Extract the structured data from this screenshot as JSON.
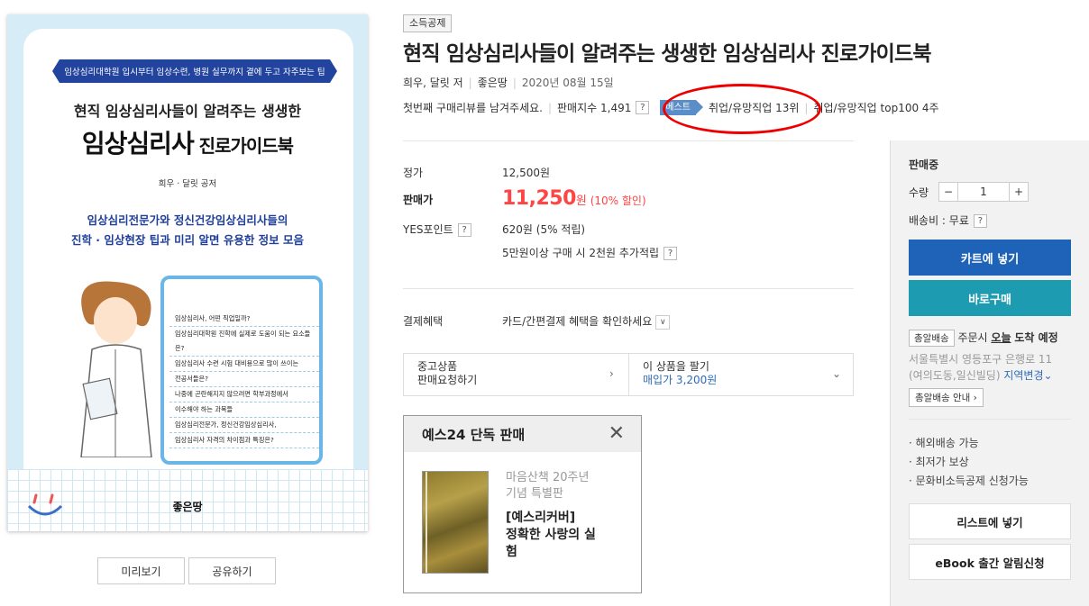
{
  "cover": {
    "banner": "임상심리대학원 입시부터 임상수련, 병원 실무까지 곁에 두고 자주보는 팁",
    "subtitle": "현직 임상심리사들이 알려주는 생생한",
    "title_main": "임상심리사",
    "title_small": " 진로가이드북",
    "authors": "희우 · 달릿 공저",
    "desc_line1": "임상심리전문가와 정신건강임상심리사들의",
    "desc_line2": "진학 · 임상현장 팁과 미리 알면 유용한 정보 모음",
    "panel_items": [
      "임상심리사, 어떤 직업일까?",
      "임상심리대학원 진학에 실제로 도움이 되는 요소들은?",
      "임상심리사 수련 시험 대비용으로 많이 쓰이는",
      "전공서들은?",
      "나중에 곤란해지지 않으려면 학부과정에서",
      "이수해야 하는 과목들",
      "임상심리전문가, 정신건강임상심리사,",
      "임상심리사 자격의 차이점과 특징은?"
    ],
    "publisher": "좋은땅"
  },
  "left_buttons": {
    "preview": "미리보기",
    "share": "공유하기"
  },
  "product": {
    "tag": "소득공제",
    "title": "현직 임상심리사들이 알려주는 생생한 임상심리사 진로가이드북",
    "authors": "희우, 달릿 저",
    "publisher": "좋은땅",
    "date": "2020년 08월 15일",
    "review_prompt": "첫번째 구매리뷰를 남겨주세요.",
    "sales_index": "판매지수 1,491",
    "help": "?",
    "best_badge": "베스트",
    "best_rank": "취업/유망직업 13위",
    "top100": "취업/유망직업 top100 4주"
  },
  "pricing": {
    "list_label": "정가",
    "list_value": "12,500원",
    "sale_label": "판매가",
    "sale_value": "11,250",
    "sale_unit": "원",
    "sale_discount": "(10% 할인)",
    "points_label": "YES포인트",
    "points_value": "620원 (5% 적립)",
    "points_extra": "5만원이상 구매 시 2천원 추가적립",
    "payment_label": "결제혜택",
    "payment_value": "카드/간편결제 혜택을 확인하세요"
  },
  "used": {
    "left_line1": "중고상품",
    "left_line2": "판매요청하기",
    "right_line1": "이 상품을 팔기",
    "right_line2": "매입가 3,200원"
  },
  "exclusive": {
    "header": "예스24 단독 판매",
    "subtitle1": "마음산책 20주년",
    "subtitle2": "기념 특별판",
    "title1": "[예스리커버]",
    "title2": "정확한 사랑의 실",
    "title3": "험"
  },
  "side": {
    "status": "판매중",
    "qty_label": "수량",
    "qty_minus": "−",
    "qty_value": "1",
    "qty_plus": "+",
    "shipping": "배송비 : 무료",
    "cart_button": "카트에 넣기",
    "buy_button": "바로구매",
    "delivery_tag": "총알배송",
    "delivery_text_pre": "주문시",
    "delivery_today": "오늘",
    "delivery_text_post": "도착 예정",
    "address1": "서울특별시 영등포구 은행로 11",
    "address2": "(여의도동,일신빌딩)",
    "change_region": "지역변경",
    "delivery_guide": "총알배송 안내",
    "bullets": [
      "해외배송 가능",
      "최저가 보상",
      "문화비소득공제 신청가능"
    ],
    "list_button": "리스트에 넣기",
    "ebook_button": "eBook 출간 알림신청"
  },
  "colors": {
    "price_red": "#f44444",
    "cart_blue": "#1f63b8",
    "buy_teal": "#1d9bb0",
    "best_badge": "#5b8ec9",
    "annotation_red": "#ee0000"
  }
}
